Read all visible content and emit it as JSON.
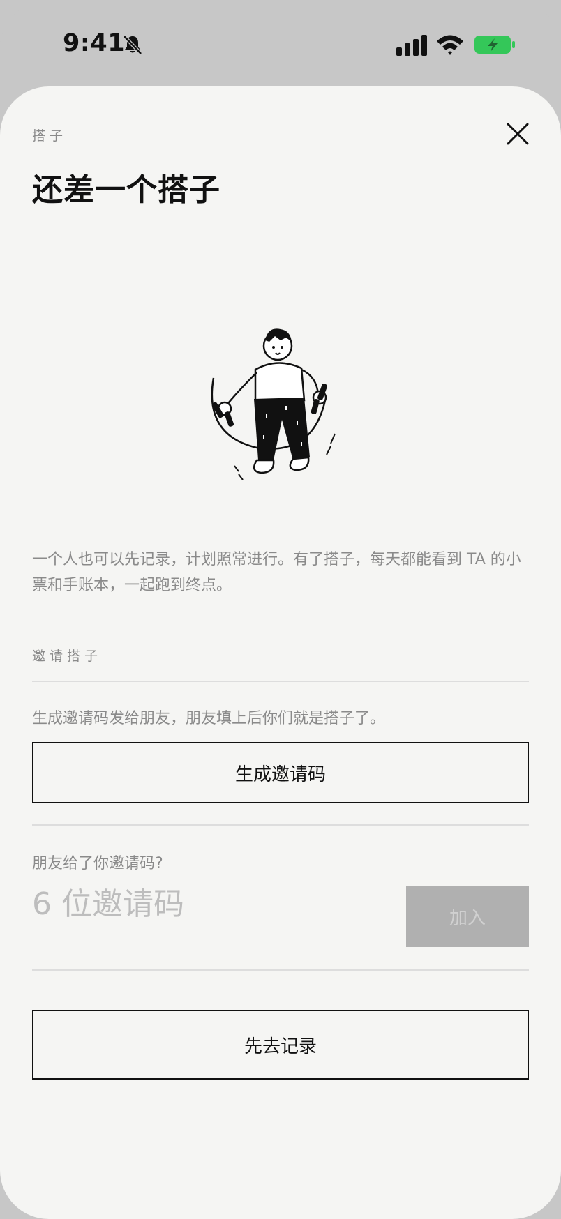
{
  "status_bar": {
    "time": "9:41",
    "icons": [
      "bell-off-icon",
      "signal-icon",
      "wifi-icon",
      "battery-charging-icon"
    ],
    "battery_color": "#34c759"
  },
  "sheet": {
    "kicker": "搭子",
    "close_icon": "close-icon",
    "title": "还差一个搭子",
    "illustration": "jump-rope-person-illustration",
    "intro": "一个人也可以先记录，计划照常进行。有了搭子，每天都能看到 TA 的小票和手账本，一起跑到终点。"
  },
  "invite": {
    "section_label": "邀请搭子",
    "description": "生成邀请码发给朋友，朋友填上后你们就是搭子了。",
    "generate_button": "生成邀请码"
  },
  "join": {
    "label": "朋友给了你邀请码?",
    "input_placeholder": "6 位邀请码",
    "join_button": "加入"
  },
  "footer": {
    "record_button": "先去记录"
  },
  "colors": {
    "sheet_bg": "#f5f5f3",
    "frame_bg": "#c7c7c7",
    "muted_text": "#8a8a8a",
    "disabled_button": "#b0b0b0"
  }
}
